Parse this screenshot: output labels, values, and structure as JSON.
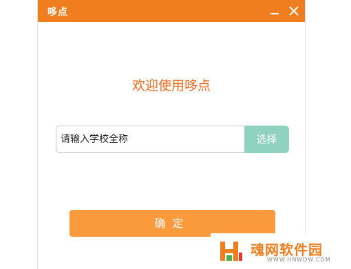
{
  "window": {
    "title": "哆点",
    "minimize_icon": "minimize-icon",
    "close_icon": "close-icon"
  },
  "main": {
    "welcome_text": "欢迎使用哆点",
    "school_input": {
      "value": "",
      "placeholder": "请输入学校全称"
    },
    "select_label": "选择",
    "confirm_label": "确定"
  },
  "watermark": {
    "text": "魂网软件园",
    "url": "WWW.HNWDW.COM"
  },
  "colors": {
    "accent": "#f07d1e",
    "welcome_text": "#f06a1e",
    "select_button": "#8fd3bf",
    "confirm_button": "#fa9a3a"
  }
}
